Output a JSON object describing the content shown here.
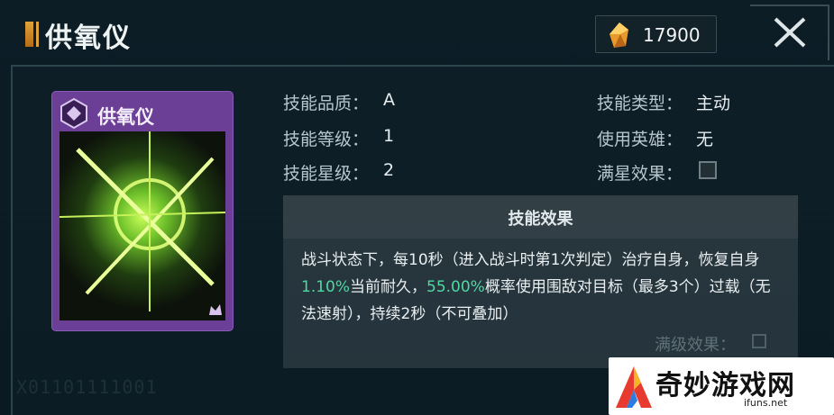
{
  "header": {
    "title": "供氧仪",
    "currency_value": "17900",
    "currency_icon": "gold-crystal-icon",
    "close_icon": "close-icon"
  },
  "card": {
    "name": "供氧仪",
    "emblem_icon": "skill-emblem-icon",
    "corner_icon": "rarity-crown-icon"
  },
  "stats": {
    "quality_label": "技能品质：",
    "quality_value": "A",
    "level_label": "技能等级：",
    "level_value": "1",
    "star_label": "技能星级：",
    "star_value": "2",
    "type_label": "技能类型：",
    "type_value": "主动",
    "hero_label": "使用英雄：",
    "hero_value": "无",
    "max_star_label": "满星效果："
  },
  "effect": {
    "title": "技能效果",
    "text_1": "战斗状态下，每10秒（进入战斗时第1次判定）治疗自身，恢复自身",
    "hl_1": "1.10%",
    "text_2": "当前耐久，",
    "hl_2": "55.00%",
    "text_3": "概率使用围敌对目标（最多3个）过载（无法速射），持续2秒（不可叠加）",
    "max_level_label": "满级效果："
  },
  "decor": {
    "id_text": "X01101111001"
  },
  "watermark": {
    "name": "奇妙游戏网",
    "url": "ifuns.net"
  },
  "colors": {
    "accent_gold": "#e0a23a",
    "highlight_green": "#4fd8a2",
    "card_purple": "#6b3f96"
  }
}
